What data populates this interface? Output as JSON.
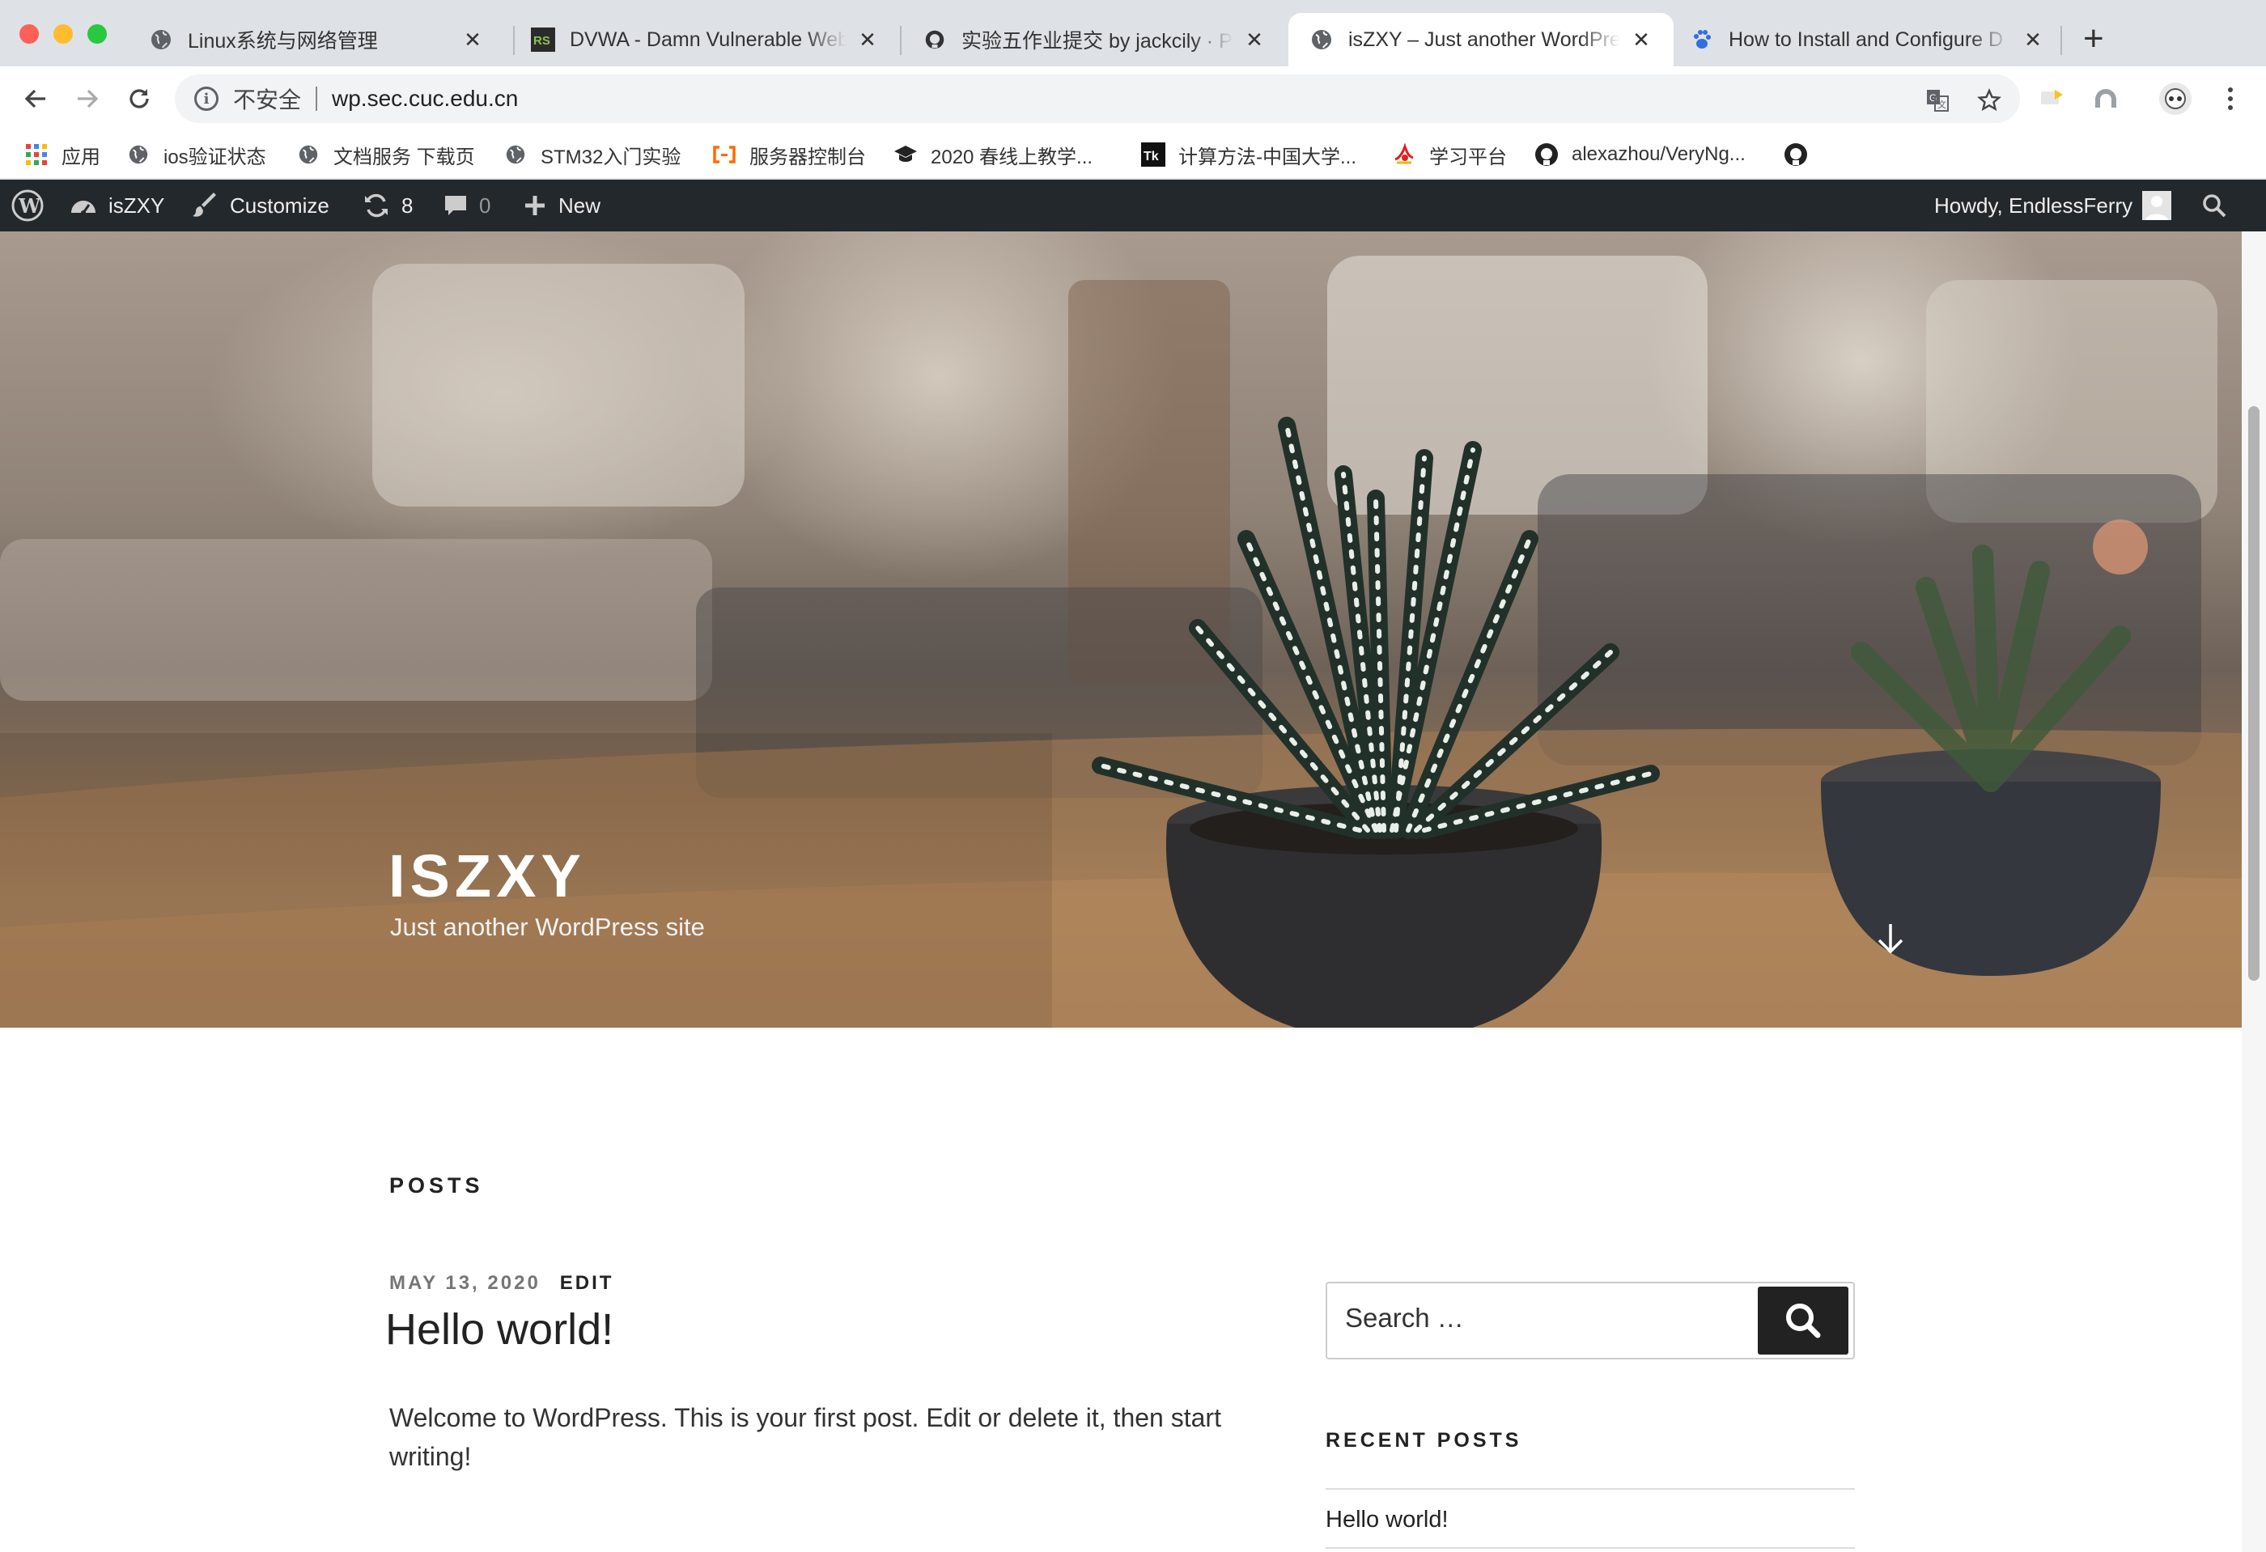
{
  "browser": {
    "tabs": [
      {
        "title": "Linux系统与网络管理",
        "icon": "globe-icon"
      },
      {
        "title": "DVWA - Damn Vulnerable Web",
        "icon": "rs-icon"
      },
      {
        "title": "实验五作业提交 by jackcily · Pu",
        "icon": "github-icon"
      },
      {
        "title": "isZXY – Just another WordPres",
        "icon": "globe-icon"
      },
      {
        "title": "How to Install and Configure D",
        "icon": "baidu-paw-icon"
      }
    ],
    "active_tab_index": 3,
    "insecure_label": "不安全",
    "url": "wp.sec.cuc.edu.cn",
    "bookmarks": [
      {
        "label": "应用",
        "icon": "apps-grid-icon"
      },
      {
        "label": "ios验证状态",
        "icon": "globe-icon"
      },
      {
        "label": "文档服务 下载页",
        "icon": "globe-icon"
      },
      {
        "label": "STM32入门实验",
        "icon": "globe-icon"
      },
      {
        "label": "服务器控制台",
        "icon": "aliyun-icon"
      },
      {
        "label": "2020 春线上教学...",
        "icon": "graduation-cap-icon"
      },
      {
        "label": "计算方法-中国大学...",
        "icon": "tk-icon"
      },
      {
        "label": "学习平台",
        "icon": "study-icon"
      },
      {
        "label": "alexazhou/VeryNg...",
        "icon": "github-icon"
      },
      {
        "label": "",
        "icon": "github-icon"
      }
    ]
  },
  "admin_bar": {
    "site_name": "isZXY",
    "customize": "Customize",
    "updates_count": "8",
    "comments_count": "0",
    "new_label": "New",
    "greeting": "Howdy, EndlessFerry"
  },
  "hero": {
    "site_title": "ISZXY",
    "tagline": "Just another WordPress site"
  },
  "main": {
    "posts_heading": "POSTS",
    "post": {
      "date": "MAY 13, 2020",
      "edit": "EDIT",
      "title": "Hello world!",
      "excerpt": "Welcome to WordPress. This is your first post. Edit or delete it, then start writing!"
    }
  },
  "sidebar": {
    "search_placeholder": "Search …",
    "recent_heading": "RECENT POSTS",
    "recent_posts": [
      "Hello world!"
    ]
  },
  "colors": {
    "admin_bar_bg": "#23282d",
    "tabstrip_bg": "#dee1e6",
    "search_button_bg": "#222222"
  }
}
